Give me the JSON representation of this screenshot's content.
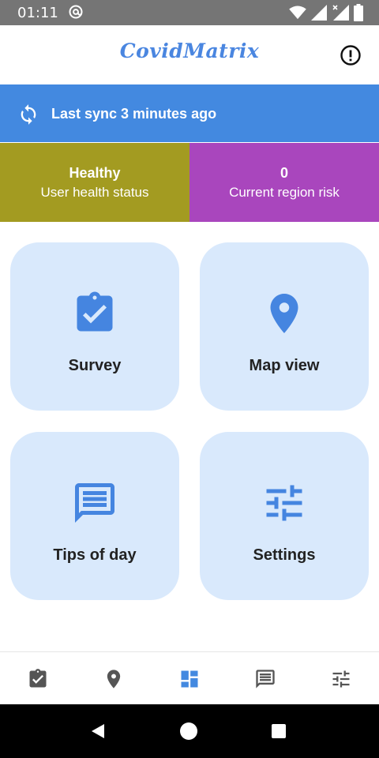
{
  "status_bar": {
    "time": "01:11",
    "icons": [
      "at-sign-icon",
      "wifi-icon",
      "cell-signal-icon",
      "cell-signal-no-data-icon",
      "battery-icon"
    ]
  },
  "app_bar": {
    "title": "CovidMatrix",
    "info_icon": "info-alert-icon"
  },
  "sync": {
    "icon": "sync-icon",
    "text": "Last sync 3 minutes ago"
  },
  "status_panels": {
    "health": {
      "value": "Healthy",
      "label": "User health status",
      "color": "#a39b21"
    },
    "risk": {
      "value": "0",
      "label": "Current region risk",
      "color": "#a946bd"
    }
  },
  "tiles": [
    {
      "label": "Survey",
      "icon": "clipboard-check-icon"
    },
    {
      "label": "Map view",
      "icon": "map-pin-icon"
    },
    {
      "label": "Tips of day",
      "icon": "message-icon"
    },
    {
      "label": "Settings",
      "icon": "sliders-icon"
    }
  ],
  "bottom_nav": {
    "items": [
      {
        "icon": "clipboard-check-icon",
        "active": false
      },
      {
        "icon": "map-pin-icon",
        "active": false
      },
      {
        "icon": "dashboard-icon",
        "active": true
      },
      {
        "icon": "message-icon",
        "active": false
      },
      {
        "icon": "sliders-icon",
        "active": false
      }
    ]
  },
  "colors": {
    "accent": "#4389e0",
    "tile_bg": "#d9e9fc",
    "icon_blue": "#4585e0",
    "nav_icon": "#555555",
    "status_bar": "#757575"
  }
}
